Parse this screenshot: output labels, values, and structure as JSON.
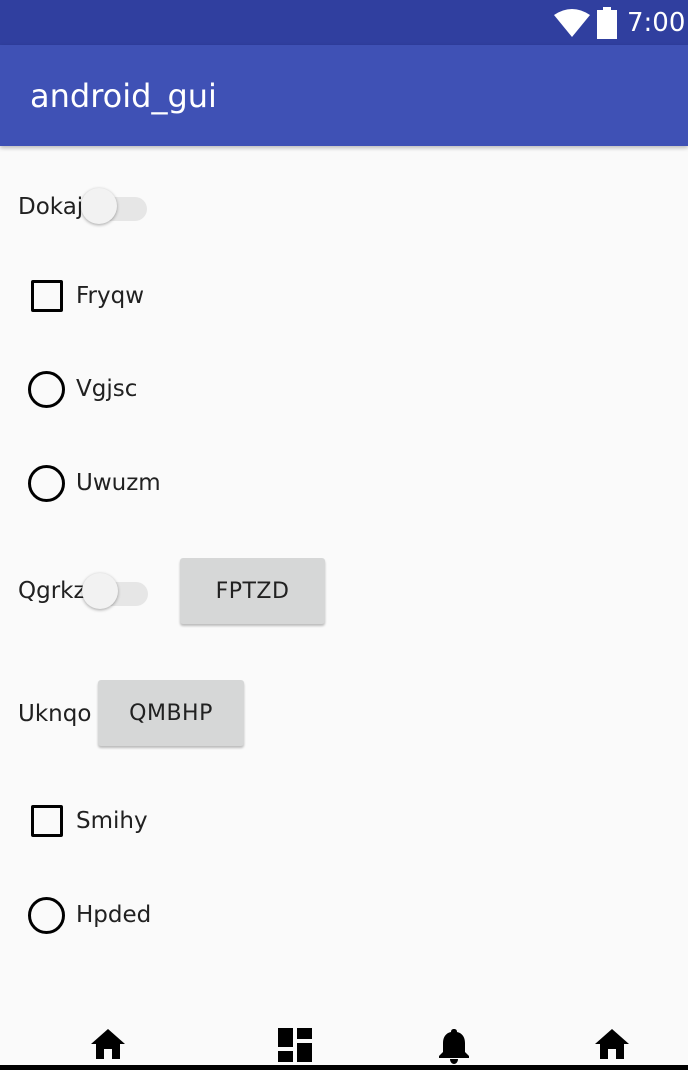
{
  "status_bar": {
    "time": "7:00",
    "icons": [
      "wifi-icon",
      "battery-icon"
    ],
    "background": "#303f9f"
  },
  "app_bar": {
    "title": "android_gui",
    "background": "#3f51b5"
  },
  "controls": {
    "switch_1": {
      "label": "Dokaj",
      "checked": false
    },
    "checkbox_1": {
      "label": "Fryqw",
      "checked": false
    },
    "radio_1": {
      "label": "Vgjsc",
      "checked": false
    },
    "radio_2": {
      "label": "Uwuzm",
      "checked": false
    },
    "switch_2": {
      "label": "Qgrkz",
      "checked": false
    },
    "button_1": {
      "label": "FPTZD"
    },
    "text_1": {
      "label": "Uknqo"
    },
    "button_2": {
      "label": "QMBHP"
    },
    "checkbox_2": {
      "label": "Smihy",
      "checked": false
    },
    "radio_3": {
      "label": "Hpded",
      "checked": false
    }
  },
  "bottom_nav": {
    "icons": [
      "home-icon",
      "dashboard-icon",
      "notifications-icon",
      "home-icon"
    ]
  }
}
